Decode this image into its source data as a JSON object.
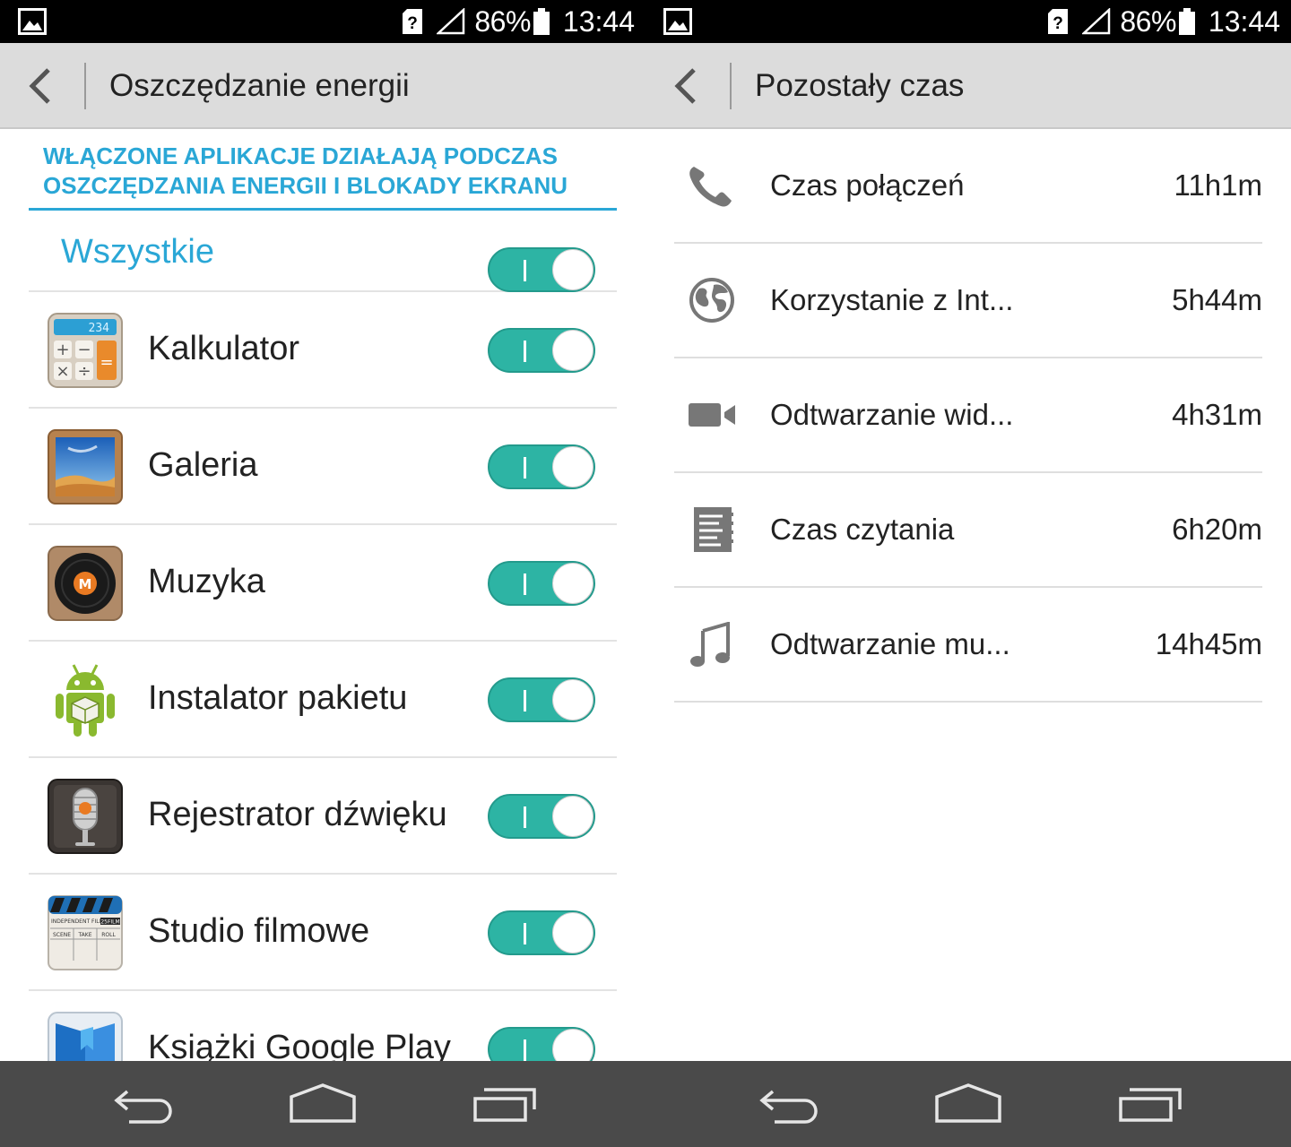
{
  "status_bar": {
    "battery": "86%",
    "time": "13:44"
  },
  "left": {
    "title": "Oszczędzanie energii",
    "header_note_line1": "WŁĄCZONE APLIKACJE DZIAŁAJĄ PODCZAS",
    "header_note_line2": "OSZCZĘDZANIA ENERGII I BLOKADY EKRANU",
    "all_label": "Wszystkie",
    "apps": [
      {
        "label": "Kalkulator",
        "icon": "calculator-icon",
        "enabled": true
      },
      {
        "label": "Galeria",
        "icon": "gallery-icon",
        "enabled": true
      },
      {
        "label": "Muzyka",
        "icon": "music-icon",
        "enabled": true
      },
      {
        "label": "Instalator pakietu",
        "icon": "android-icon",
        "enabled": true
      },
      {
        "label": "Rejestrator dźwięku",
        "icon": "microphone-icon",
        "enabled": true
      },
      {
        "label": "Studio filmowe",
        "icon": "clapperboard-icon",
        "enabled": true
      },
      {
        "label": "Książki Google Play",
        "icon": "book-icon",
        "enabled": true
      }
    ],
    "calc_display": "234",
    "clapper_text": "INDEPENDENT FILM",
    "clapper_film": "25FILM",
    "clapper_cols": [
      "SCENE",
      "TAKE",
      "ROLL"
    ]
  },
  "right": {
    "title": "Pozostały czas",
    "items": [
      {
        "label": "Czas połączeń",
        "value": "11h1m",
        "icon": "phone-icon"
      },
      {
        "label": "Korzystanie z Int...",
        "value": "5h44m",
        "icon": "globe-icon"
      },
      {
        "label": "Odtwarzanie wid...",
        "value": "4h31m",
        "icon": "video-camera-icon"
      },
      {
        "label": "Czas czytania",
        "value": "6h20m",
        "icon": "document-icon"
      },
      {
        "label": "Odtwarzanie mu...",
        "value": "14h45m",
        "icon": "music-note-icon"
      }
    ]
  },
  "colors": {
    "accent": "#2aa7d6",
    "toggle_on": "#2db4a4",
    "navbar": "#4a4a4a",
    "actionbar": "#dcdcdc"
  }
}
